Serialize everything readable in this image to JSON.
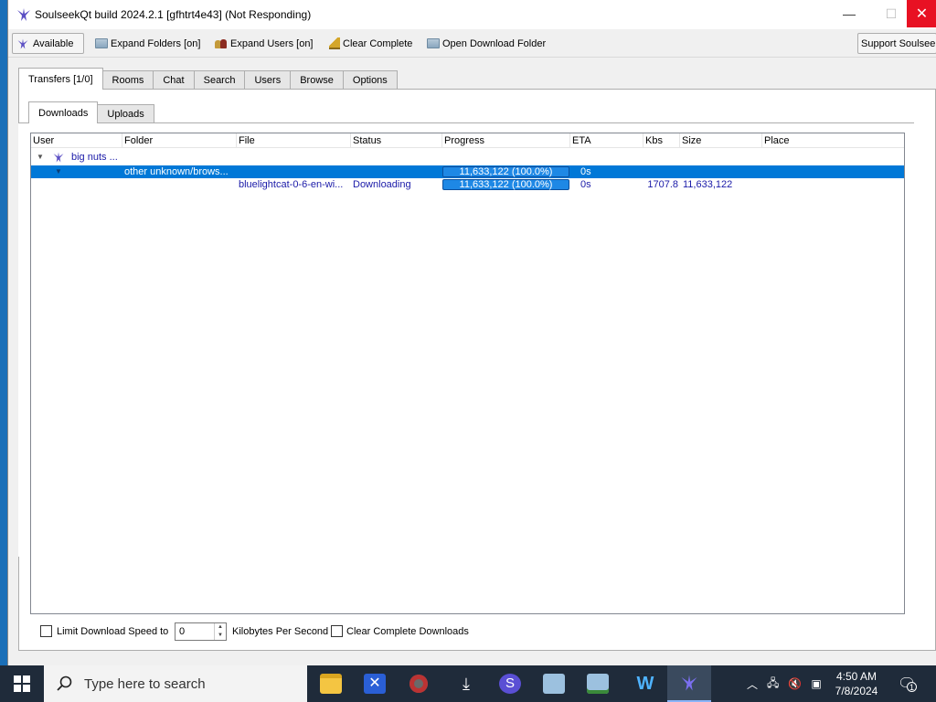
{
  "window": {
    "title": "SoulseekQt build 2024.2.1 [gfhtrt4e43] (Not Responding)",
    "controls": {
      "minimize": "—",
      "maximize": "☐",
      "close": "✕"
    }
  },
  "toolbar": {
    "status_label": "Available",
    "expand_folders_label": "Expand Folders [on]",
    "expand_users_label": "Expand Users [on]",
    "clear_complete_label": "Clear Complete",
    "open_download_folder_label": "Open Download Folder",
    "support_label": "Support Soulseek"
  },
  "main_tabs": [
    "Transfers [1/0]",
    "Rooms",
    "Chat",
    "Search",
    "Users",
    "Browse",
    "Options"
  ],
  "sub_tabs": [
    "Downloads",
    "Uploads"
  ],
  "table": {
    "columns": [
      "User",
      "Folder",
      "File",
      "Status",
      "Progress",
      "ETA",
      "Kbs",
      "Size",
      "Place"
    ],
    "user_row": {
      "user": "big nuts ..."
    },
    "folder_row": {
      "folder": "other unknown/brows...",
      "progress": "11,633,122 (100.0%)",
      "eta": "0s"
    },
    "file_row": {
      "file": "bluelightcat-0-6-en-wi...",
      "status": "Downloading",
      "progress": "11,633,122 (100.0%)",
      "eta": "0s",
      "kbs": "1707.8",
      "size": "11,633,122"
    }
  },
  "bottom": {
    "limit_label": "Limit Download Speed to",
    "speed_value": "0",
    "unit_label": "Kilobytes Per Second",
    "clear_complete_downloads_label": "Clear Complete Downloads"
  },
  "taskbar": {
    "search_placeholder": "Type here to search",
    "time": "4:50 AM",
    "date": "7/8/2024",
    "notification_count": "1"
  },
  "colors": {
    "selection": "#0078d7",
    "progress_fill": "#1e88e5",
    "link_text": "#1a1aa8",
    "close_button": "#e81123",
    "taskbar": "#1f2b3a"
  },
  "progress": {
    "folder_row": 1.0,
    "file_row": 1.0
  }
}
